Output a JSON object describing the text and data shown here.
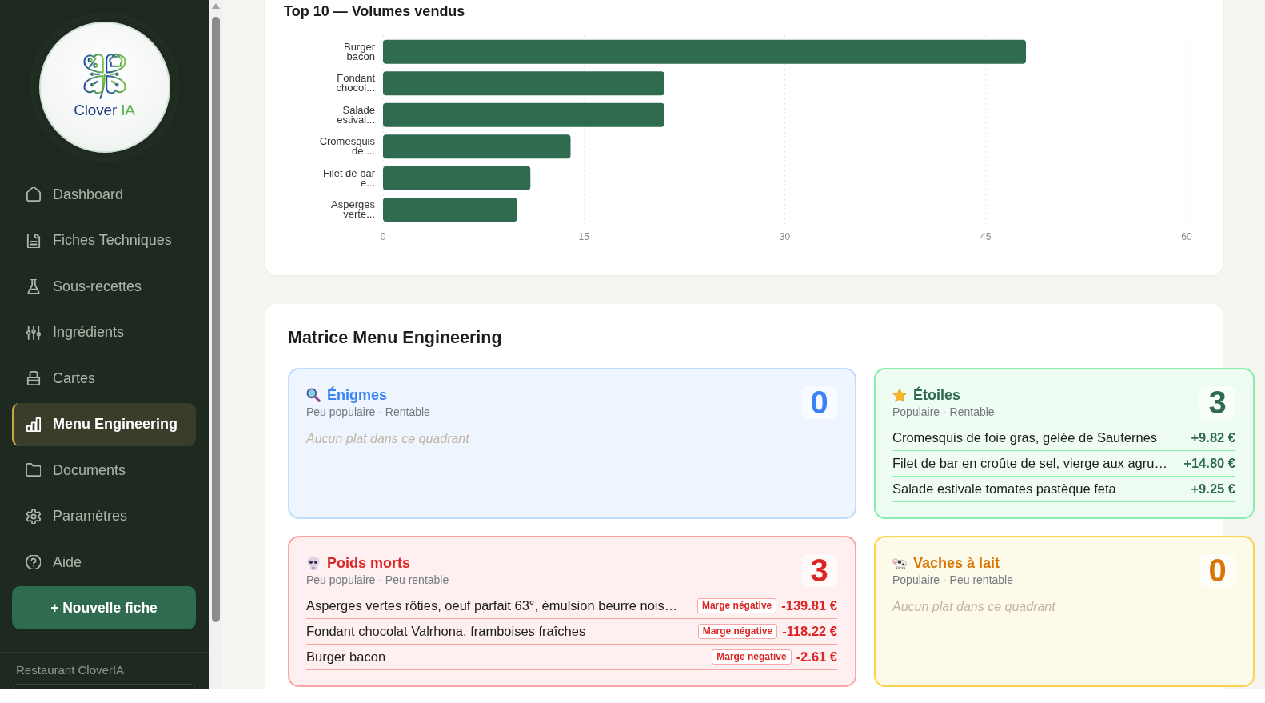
{
  "sidebar": {
    "logo": {
      "name": "Clover",
      "suffix": "IA"
    },
    "nav": [
      {
        "label": "Dashboard",
        "selected": false
      },
      {
        "label": "Fiches Techniques",
        "selected": false
      },
      {
        "label": "Sous-recettes",
        "selected": false
      },
      {
        "label": "Ingrédients",
        "selected": false
      },
      {
        "label": "Cartes",
        "selected": false
      },
      {
        "label": "Menu Engineering",
        "selected": true
      },
      {
        "label": "Documents",
        "selected": false
      },
      {
        "label": "Paramètres",
        "selected": false
      },
      {
        "label": "Aide",
        "selected": false
      }
    ],
    "new_button": {
      "label": "+ Nouvelle fiche"
    },
    "restaurant": {
      "label": "Restaurant CloverIA"
    }
  },
  "top_chart": {
    "chart_data": {
      "type": "bar",
      "orientation": "horizontal",
      "title": "Top 10 — Volumes vendus",
      "categories": [
        "Burger bacon",
        "Fondant chocol...",
        "Salade estival...",
        "Cromesquis de ...",
        "Filet de bar e...",
        "Asperges verte..."
      ],
      "values": [
        48,
        21,
        21,
        14,
        11,
        10
      ],
      "xlim": [
        0,
        60
      ],
      "xticks": [
        0,
        15,
        30,
        45,
        60
      ],
      "grid": true
    }
  },
  "matrix": {
    "title": "Matrice Menu Engineering",
    "quadrants": [
      {
        "kind": "enigmes",
        "title": "Énigmes",
        "subtitle": "Peu populaire · Rentable",
        "count": "0",
        "empty_text": "Aucun plat dans ce quadrant"
      },
      {
        "kind": "etoiles",
        "title": "Étoiles",
        "subtitle": "Populaire · Rentable",
        "count": "3",
        "items": [
          {
            "name": "Cromesquis de foie gras, gelée de Sauternes",
            "value": "+9.82 €"
          },
          {
            "name": "Filet de bar en croûte de sel, vierge aux agru…",
            "value": "+14.80 €"
          },
          {
            "name": "Salade estivale tomates pastèque feta",
            "value": "+9.25 €"
          }
        ]
      },
      {
        "kind": "poids_morts",
        "title": "Poids morts",
        "subtitle": "Peu populaire · Peu rentable",
        "count": "3",
        "items": [
          {
            "name": "Asperges vertes rôties, oeuf parfait 63°, émulsion beurre nois…",
            "badge": "Marge négative",
            "value": "-139.81 €"
          },
          {
            "name": "Fondant chocolat Valrhona, framboises fraîches",
            "badge": "Marge négative",
            "value": "-118.22 €"
          },
          {
            "name": "Burger bacon",
            "badge": "Marge négative",
            "value": "-2.61 €"
          }
        ]
      },
      {
        "kind": "vaches",
        "title": "Vaches à lait",
        "subtitle": "Populaire · Peu rentable",
        "count": "0",
        "empty_text": "Aucun plat dans ce quadrant"
      }
    ]
  }
}
